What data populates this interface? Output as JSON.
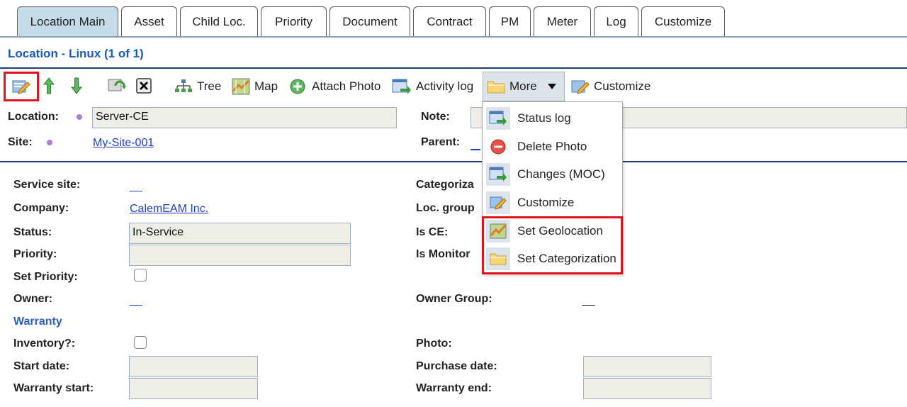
{
  "tabs": [
    {
      "label": "Location Main",
      "active": true
    },
    {
      "label": "Asset"
    },
    {
      "label": "Child Loc."
    },
    {
      "label": "Priority"
    },
    {
      "label": "Document"
    },
    {
      "label": "Contract"
    },
    {
      "label": "PM"
    },
    {
      "label": "Meter"
    },
    {
      "label": "Log"
    },
    {
      "label": "Customize"
    }
  ],
  "title": "Location - Linux (1 of 1)",
  "toolbar": {
    "tree_label": "Tree",
    "map_label": "Map",
    "attach_photo_label": "Attach Photo",
    "activity_log_label": "Activity log",
    "more_label": "More",
    "customize_label": "Customize"
  },
  "header_form": {
    "location_label": "Location:",
    "location_value": "Server-CE",
    "site_label": "Site:",
    "site_value": "My-Site-001",
    "note_label": "Note:",
    "parent_label": "Parent:"
  },
  "menu": {
    "items": [
      {
        "label": "Status log",
        "icon": "status-log-icon"
      },
      {
        "label": "Delete Photo",
        "icon": "delete-photo-icon"
      },
      {
        "label": "Changes (MOC)",
        "icon": "changes-moc-icon"
      },
      {
        "label": "Customize",
        "icon": "customize-icon"
      },
      {
        "label": "Set Geolocation",
        "icon": "map-icon"
      },
      {
        "label": "Set Categorization",
        "icon": "folder-icon"
      }
    ]
  },
  "form": {
    "service_site_label": "Service site:",
    "service_site_value": "__",
    "company_label": "Company:",
    "company_value": "CalemEAM Inc.",
    "status_label": "Status:",
    "status_value": "In-Service",
    "priority_label": "Priority:",
    "priority_value": "",
    "set_priority_label": "Set Priority:",
    "owner_label": "Owner:",
    "owner_value": "__",
    "warranty_section": "Warranty",
    "inventory_label": "Inventory?:",
    "start_date_label": "Start date:",
    "warranty_start_label": "Warranty start:",
    "categorization_label": "Categoriza",
    "loc_group_label": "Loc. group",
    "is_ce_label": "Is CE:",
    "is_monitor_label": "Is Monitor",
    "owner_group_label": "Owner Group:",
    "owner_group_value": "__",
    "photo_label": "Photo:",
    "purchase_date_label": "Purchase date:",
    "warranty_end_label": "Warranty end:"
  },
  "colors": {
    "accent": "#1a5bb8",
    "highlight": "#e0141b",
    "active_tab": "#c6dbe8"
  }
}
